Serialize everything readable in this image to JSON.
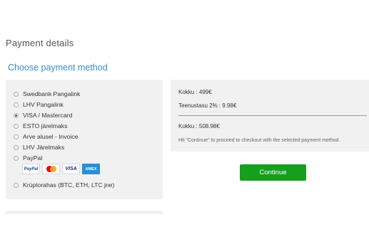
{
  "page": {
    "title": "Payment details"
  },
  "methods_section": {
    "title": "Choose payment method",
    "options": [
      {
        "label": "Swedbank Pangalink",
        "selected": false
      },
      {
        "label": "LHV Pangalink",
        "selected": false
      },
      {
        "label": "VISA / Mastercard",
        "selected": true
      },
      {
        "label": "ESTO järelmaks",
        "selected": false
      },
      {
        "label": "Arve alusel - Invoice",
        "selected": false
      },
      {
        "label": "LHV Järelmaks",
        "selected": false
      },
      {
        "label": "PayPal",
        "selected": false
      },
      {
        "label": "Krüptorahas (BTC, ETH, LTC jne)",
        "selected": false
      }
    ],
    "paypal_logos": [
      {
        "name": "paypal-logo-icon",
        "text": "PayPal"
      },
      {
        "name": "mastercard-logo-icon",
        "text": ""
      },
      {
        "name": "visa-logo-icon",
        "text": "VISA"
      },
      {
        "name": "amex-logo-icon",
        "text": "AMEX"
      }
    ]
  },
  "summary": {
    "total": "Kokku : 499€",
    "fee": "Teenustasu 2% : 9.98€",
    "grand_total": "Kokku : 508.98€",
    "hint": "Hit \"Continue\" to proceed to checkout with the selected payment method."
  },
  "actions": {
    "continue_label": "Continue"
  },
  "colors": {
    "accent_link": "#3a8ccf",
    "continue_button": "#14a01e",
    "panel_bg": "#f1f1f1"
  }
}
